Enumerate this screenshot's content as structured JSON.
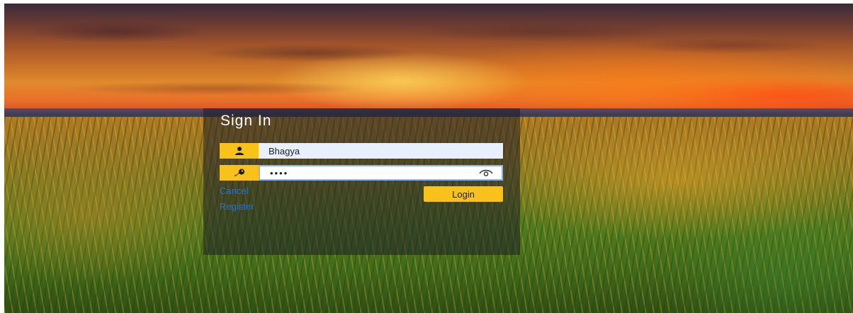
{
  "signin": {
    "title": "Sign In",
    "username": {
      "value": "Bhagya",
      "icon": "user-icon"
    },
    "password": {
      "value": "••••",
      "icon": "key-icon",
      "toggle_icon": "eye-icon"
    },
    "cancel_label": "Cancel",
    "register_label": "Register",
    "login_label": "Login"
  },
  "colors": {
    "accent": "#f9c21a",
    "link": "#1e73e8",
    "panel": "#1e1e28",
    "input_bg": "#e8f0fe"
  }
}
